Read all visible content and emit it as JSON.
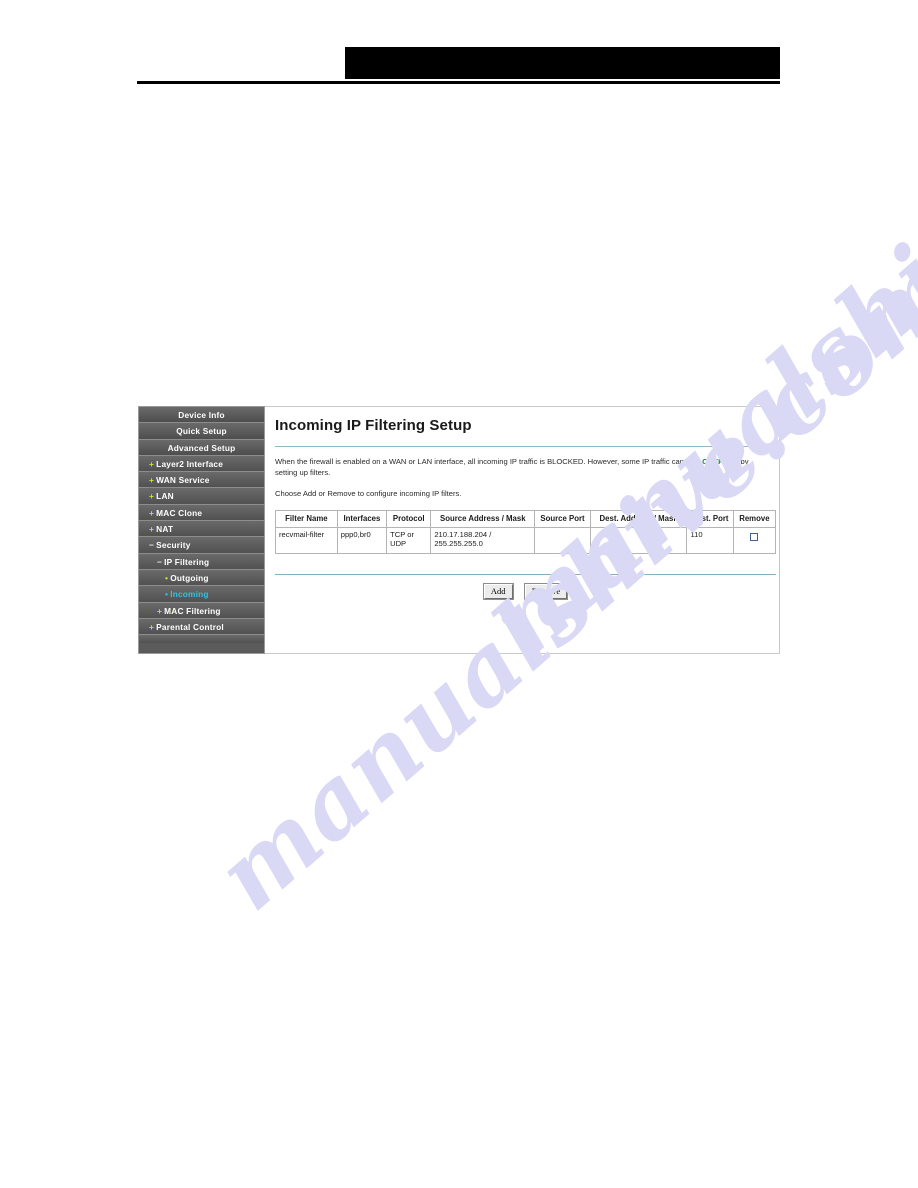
{
  "header": {
    "redacted_bar": "",
    "rule": ""
  },
  "watermark": {
    "line1": "manualshive.com",
    "line2": "manualshive.com",
    "color": "#d9d8f5"
  },
  "sidebar": {
    "items": [
      {
        "label": "Device Info",
        "level": 0,
        "marker": "",
        "active": false
      },
      {
        "label": "Quick Setup",
        "level": 0,
        "marker": "",
        "active": false
      },
      {
        "label": "Advanced Setup",
        "level": 0,
        "marker": "",
        "active": false
      },
      {
        "label": "Layer2 Interface",
        "level": 1,
        "marker": "+",
        "active": false
      },
      {
        "label": "WAN Service",
        "level": 1,
        "marker": "+",
        "active": false
      },
      {
        "label": "LAN",
        "level": 1,
        "marker": "+",
        "active": false
      },
      {
        "label": "MAC Clone",
        "level": 1,
        "marker": "+",
        "active": false
      },
      {
        "label": "NAT",
        "level": 1,
        "marker": "+",
        "active": false
      },
      {
        "label": "Security",
        "level": 1,
        "marker": "−",
        "active": false
      },
      {
        "label": "IP Filtering",
        "level": 2,
        "marker": "−",
        "active": false
      },
      {
        "label": "Outgoing",
        "level": 3,
        "marker": "•",
        "active": false
      },
      {
        "label": "Incoming",
        "level": 3,
        "marker": "•",
        "active": true
      },
      {
        "label": "MAC Filtering",
        "level": 2,
        "marker": "+",
        "active": false
      },
      {
        "label": "Parental Control",
        "level": 1,
        "marker": "+",
        "active": false
      }
    ],
    "colors": {
      "background": "#5b5b5b",
      "text": "#ffffff",
      "bullet": "#cddc39",
      "active_text": "#2ec3e8"
    }
  },
  "content": {
    "title": "Incoming IP Filtering Setup",
    "intro_part1": "When the firewall is enabled on a WAN or LAN interface, all incoming IP traffic is BLOCKED. However, some IP traffic can be ",
    "intro_accepted": "ACCEPTED",
    "intro_part2": " by setting up filters.",
    "intro_line2": "Choose Add or Remove to configure incoming IP filters.",
    "accepted_color": "#0f8a2f"
  },
  "table": {
    "headers": [
      "Filter Name",
      "Interfaces",
      "Protocol",
      "Source Address / Mask",
      "Source Port",
      "Dest. Address / Mask",
      "Dest. Port",
      "Remove"
    ],
    "rows": [
      {
        "filter_name": "recvmail-filter",
        "interfaces": "ppp0,br0",
        "protocol": "TCP or UDP",
        "source_address_mask": "210.17.188.204 / 255.255.255.0",
        "source_port": "",
        "dest_address_mask": "",
        "dest_port": "110",
        "remove_checked": false
      }
    ]
  },
  "buttons": {
    "add": "Add",
    "remove": "Remove"
  }
}
